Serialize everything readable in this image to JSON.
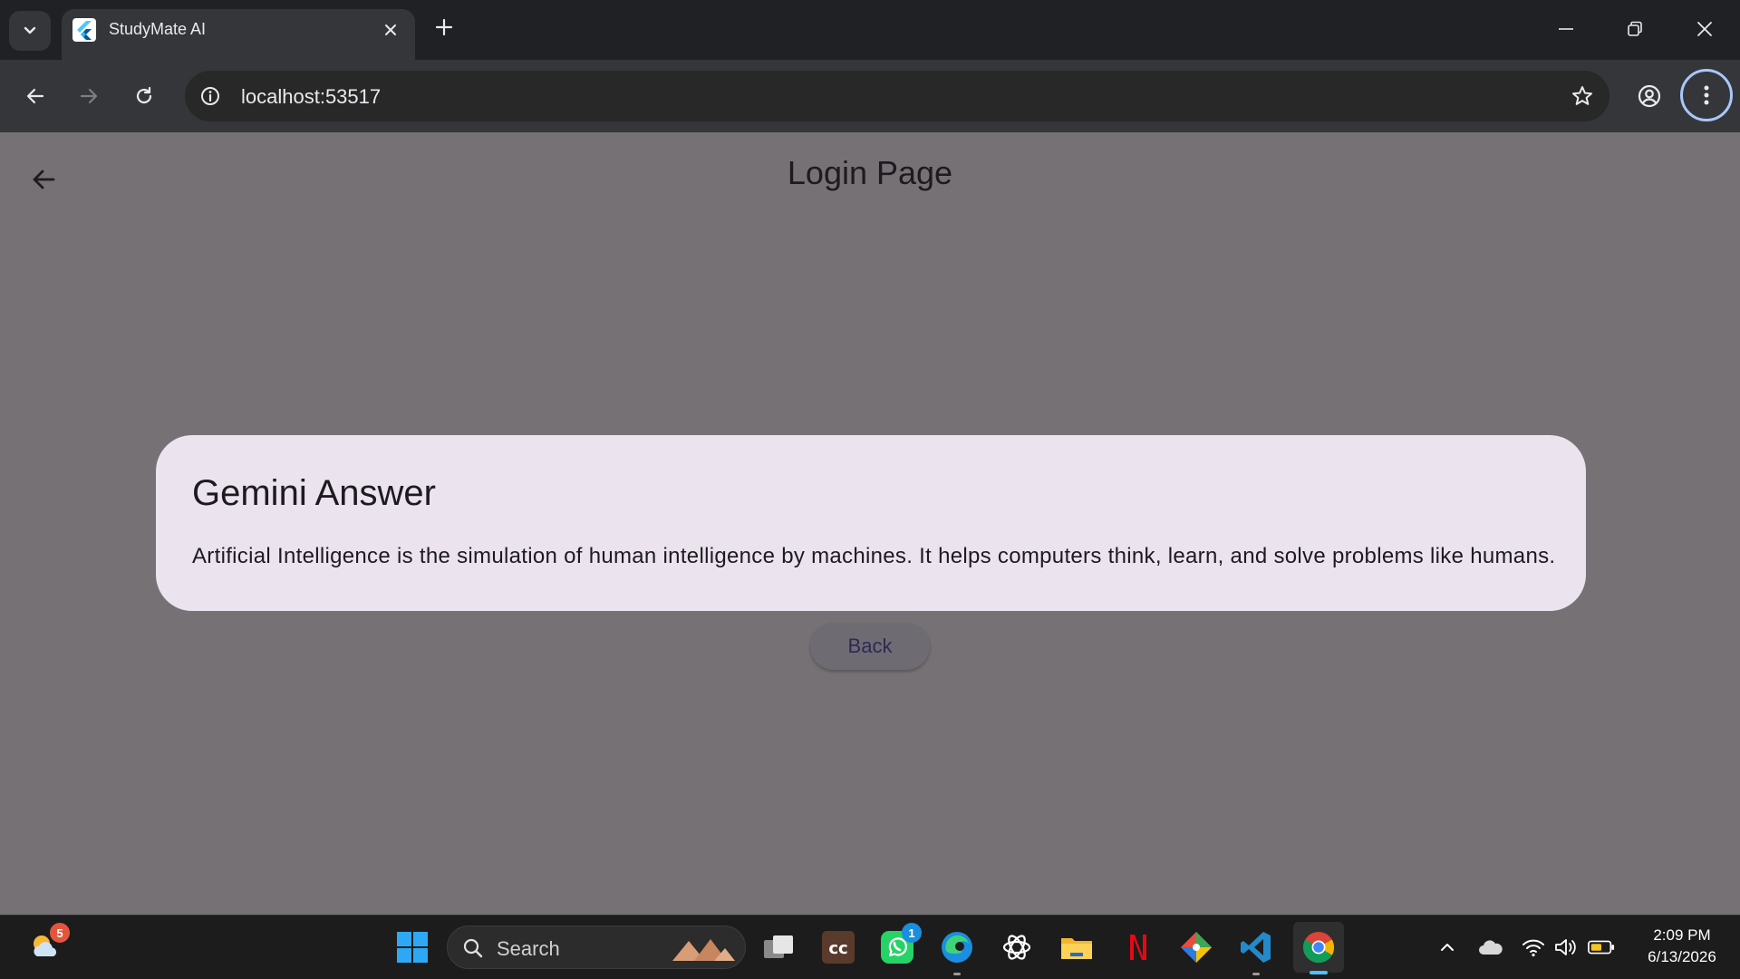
{
  "browser": {
    "tab_title": "StudyMate AI",
    "url": "localhost:53517"
  },
  "page": {
    "appbar_title": "Login Page",
    "dialog": {
      "title": "Gemini Answer",
      "body": "Artificial Intelligence is the simulation of human intelligence by machines. It helps computers think, learn, and solve problems like humans."
    },
    "back_button_label": "Back"
  },
  "taskbar": {
    "weather_badge": "5",
    "search_label": "Search",
    "whatsapp_badge": "1",
    "clock_time": "2:09 PM",
    "clock_date": "6/13/2026"
  },
  "colors": {
    "page_background": "#767175",
    "dialog_background": "#ebe4ef",
    "focus_ring": "#a8c7fa",
    "active_app_indicator": "#4cc2ff"
  }
}
